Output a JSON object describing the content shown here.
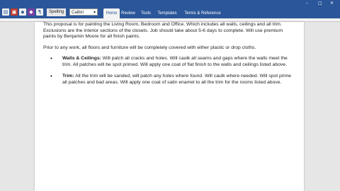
{
  "window": {
    "minimize": "–",
    "maximize": "□",
    "close": "✕"
  },
  "quick_access": {
    "style_name": "Spelling",
    "font_name": "Calibri",
    "font_dropdown": "▾"
  },
  "tabs": [
    "Home",
    "Review",
    "Tools",
    "Templates",
    "Terms & Reference Lists"
  ],
  "document": {
    "para1": "This proposal is for painting the Living Room, Bedroom and Office. Which includes all walls, ceilings and all trim. Exclusions are the interior sections of the closets. Job should take about 5-6 days to complete. Will use premium paints by Benjamin Moore for all finish paints.",
    "para2": "Prior to any work, all floors and furniture will be completely covered with either plastic or drop cloths.",
    "bullet1_title": "Walls & Ceilings:",
    "bullet1_text": " Will patch all cracks and holes. Will caulk all seams and gaps where the walls meet the trim. All patches will be spot primed. Will apply one coat of flat finish to the walls and ceilings listed above.",
    "bullet2_title": "Trim:",
    "bullet2_text": " All the trim will be sanded, will patch any holes where found. Will caulk where needed. Will spot prime all patches and bad areas. Will apply one coat of satin enamel to all the trim for the rooms listed above.",
    "bullet_glyph": "•"
  },
  "colors": {
    "accent": "#2b579a",
    "ribbon": "#f3f3f3",
    "workspace": "#e6e6e6"
  }
}
